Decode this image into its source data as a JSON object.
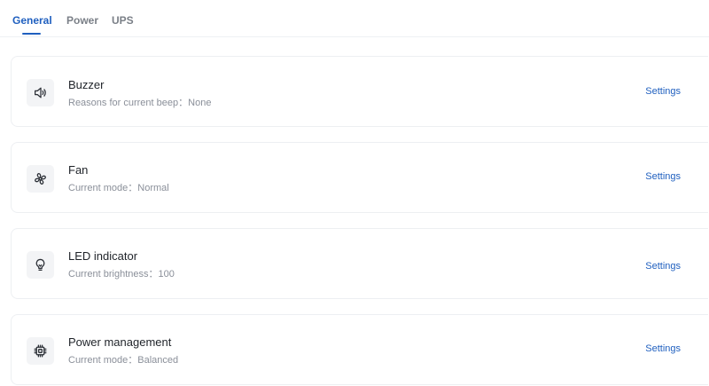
{
  "tabs": [
    {
      "label": "General",
      "active": true
    },
    {
      "label": "Power",
      "active": false
    },
    {
      "label": "UPS",
      "active": false
    }
  ],
  "cards": [
    {
      "icon": "speaker-icon",
      "title": "Buzzer",
      "subtitle_label": "Reasons for current beep",
      "subtitle_value": "None",
      "action": "Settings"
    },
    {
      "icon": "fan-icon",
      "title": "Fan",
      "subtitle_label": "Current mode",
      "subtitle_value": "Normal",
      "action": "Settings"
    },
    {
      "icon": "lightbulb-icon",
      "title": "LED indicator",
      "subtitle_label": "Current brightness",
      "subtitle_value": "100",
      "action": "Settings"
    },
    {
      "icon": "cpu-chip-icon",
      "title": "Power management",
      "subtitle_label": "Current mode",
      "subtitle_value": "Balanced",
      "action": "Settings"
    }
  ],
  "colors": {
    "accent": "#1f5fbf",
    "muted_text": "#8a8f99",
    "card_border": "#edeff2",
    "icon_bg": "#f3f4f6"
  }
}
